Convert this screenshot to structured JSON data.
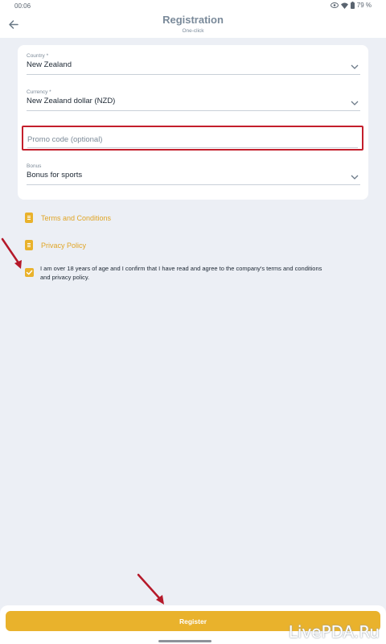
{
  "status_bar": {
    "time": "00:06",
    "battery": "79 %"
  },
  "header": {
    "title": "Registration",
    "subtitle": "One-click"
  },
  "form": {
    "country": {
      "label": "Country *",
      "value": "New Zealand"
    },
    "currency": {
      "label": "Currency *",
      "value": "New Zealand dollar (NZD)"
    },
    "promo": {
      "placeholder": "Promo code (optional)"
    },
    "bonus": {
      "label": "Bonus",
      "value": "Bonus for sports"
    }
  },
  "links": {
    "terms": "Terms and Conditions",
    "privacy": "Privacy Policy"
  },
  "agreement": {
    "checked": true,
    "text": "I am over 18 years of age and I confirm that I have read and agree to the company's terms and conditions and privacy policy."
  },
  "register_button": "Register",
  "watermark": "LivePDA.Ru",
  "colors": {
    "accent": "#e9b22c",
    "highlight": "#c41f2c",
    "annotation_arrow": "#b5192a",
    "background": "#eceff5"
  },
  "icons": [
    "eye-icon",
    "wifi-icon",
    "battery-icon",
    "back-arrow-icon",
    "chevron-down-icon",
    "document-icon",
    "check-icon"
  ]
}
